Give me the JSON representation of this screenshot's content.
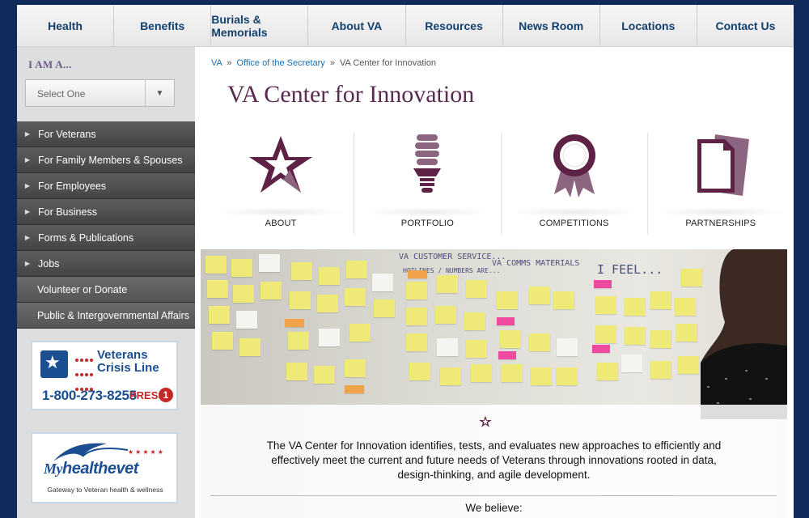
{
  "topnav": {
    "items": [
      "Health",
      "Benefits",
      "Burials & Memorials",
      "About VA",
      "Resources",
      "News Room",
      "Locations",
      "Contact Us"
    ]
  },
  "sidebar": {
    "iam_label": "I AM A...",
    "select_value": "Select One",
    "menu": [
      {
        "label": "For Veterans",
        "arrow": true
      },
      {
        "label": "For Family Members & Spouses",
        "arrow": true
      },
      {
        "label": "For Employees",
        "arrow": true
      },
      {
        "label": "For Business",
        "arrow": true
      },
      {
        "label": "Forms & Publications",
        "arrow": true
      },
      {
        "label": "Jobs",
        "arrow": true
      },
      {
        "label": "Volunteer or Donate",
        "arrow": false
      },
      {
        "label": "Public & Intergovernmental Affairs",
        "arrow": false
      }
    ],
    "crisis_line": {
      "title": "Veterans Crisis Line",
      "phone": "1-800-273-8255",
      "press": "PRESS",
      "press_number": "1"
    },
    "myhealthevet": {
      "my": "My",
      "name": "healthevet",
      "tagline": "Gateway to Veteran health & wellness"
    }
  },
  "breadcrumb": {
    "items": [
      "VA",
      "Office of the Secretary",
      "VA Center for Innovation"
    ],
    "separator": "»"
  },
  "page_title": "VA Center for Innovation",
  "tiles": [
    {
      "label": "ABOUT",
      "icon": "star-icon"
    },
    {
      "label": "PORTFOLIO",
      "icon": "lightbulb-icon"
    },
    {
      "label": "COMPETITIONS",
      "icon": "ribbon-award-icon"
    },
    {
      "label": "PARTNERSHIPS",
      "icon": "documents-icon"
    }
  ],
  "hero": {
    "board_text": [
      "VA CUSTOMER SERVICE...",
      "VA COMMS MATERIALS",
      "I FEEL...",
      "HOTLINES / NUMBERS ARE..."
    ],
    "description": "The VA Center for Innovation identifies, tests, and evaluates new approaches to efficiently and effectively meet the current and future needs of Veterans through innovations rooted in data, design-thinking, and agile development.",
    "believe": "We believe:"
  },
  "colors": {
    "brand_purple": "#5a2a52",
    "icon_purple": "#5e2246",
    "icon_mauve": "#8c6680",
    "nav_text": "#12406e",
    "link": "#1a6fb3",
    "page_bg": "#112a5c"
  }
}
